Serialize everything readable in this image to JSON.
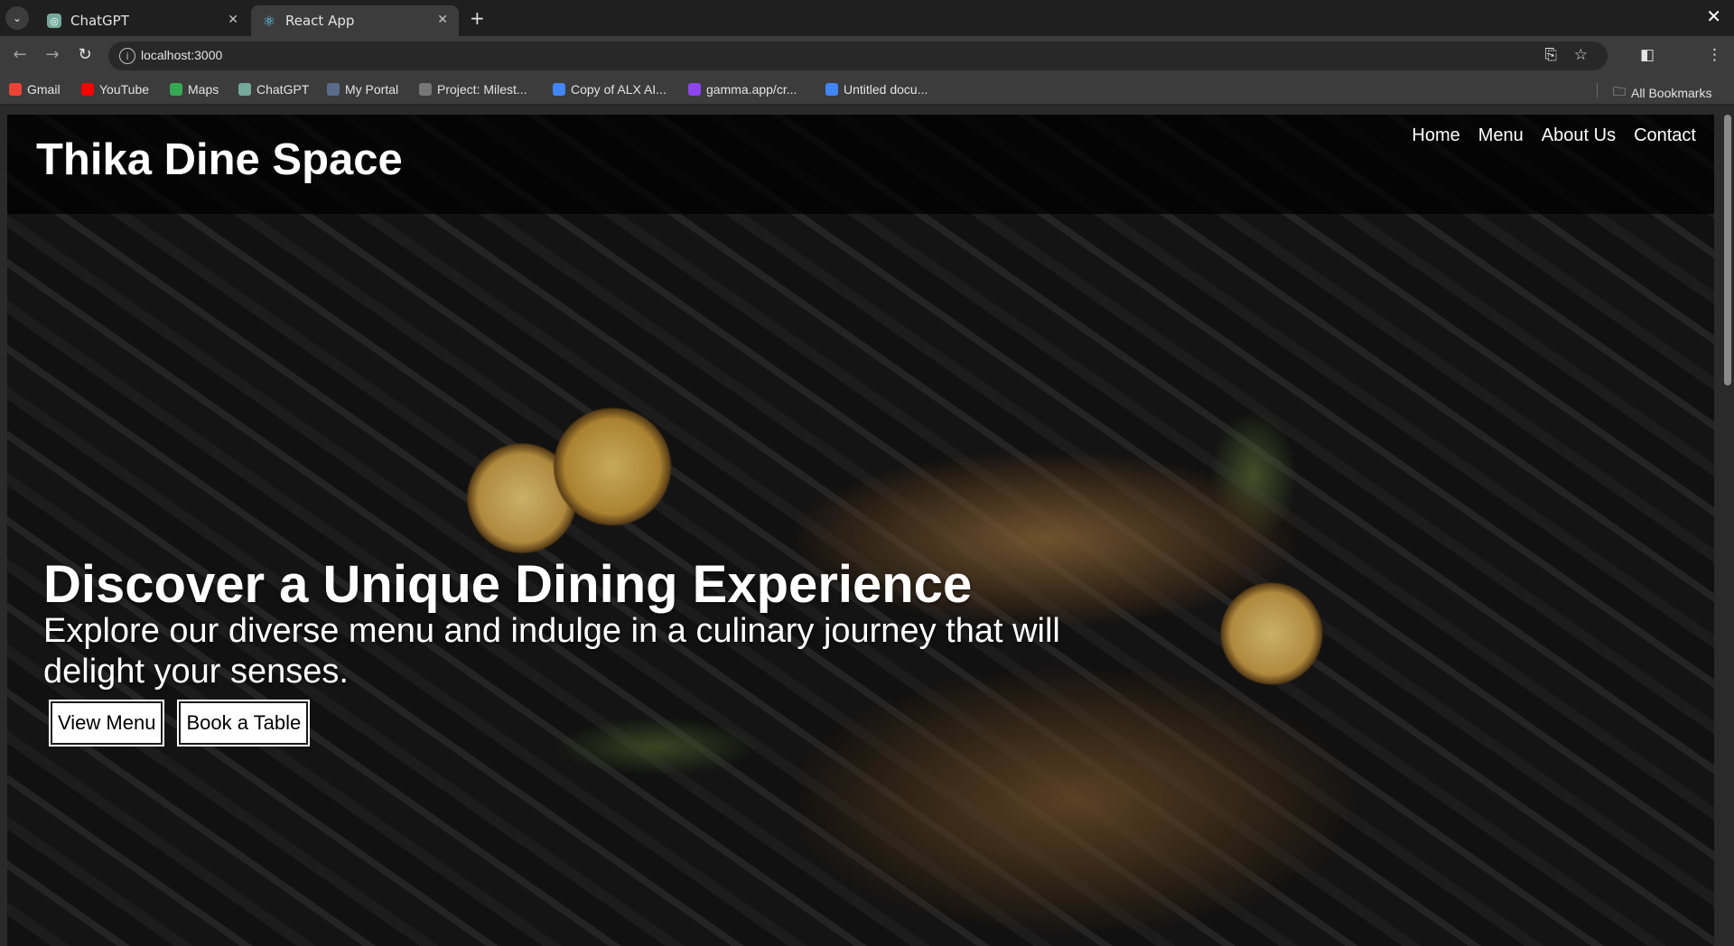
{
  "browser": {
    "tabs": [
      {
        "title": "ChatGPT",
        "active": false
      },
      {
        "title": "React App",
        "active": true
      }
    ],
    "url": "localhost:3000",
    "bookmarks": [
      {
        "label": "Gmail",
        "icon": "gmail-icon",
        "color": "#ea4335"
      },
      {
        "label": "YouTube",
        "icon": "youtube-icon",
        "color": "#ff0000"
      },
      {
        "label": "Maps",
        "icon": "maps-icon",
        "color": "#34a853"
      },
      {
        "label": "ChatGPT",
        "icon": "chatgpt-icon",
        "color": "#74aa9c"
      },
      {
        "label": "My Portal",
        "icon": "portal-icon",
        "color": "#5a6b8c"
      },
      {
        "label": "Project: Milest...",
        "icon": "project-icon",
        "color": "#777777"
      },
      {
        "label": "Copy of ALX AI...",
        "icon": "docs-icon",
        "color": "#4285f4"
      },
      {
        "label": "gamma.app/cr...",
        "icon": "gamma-icon",
        "color": "#8e44ef"
      },
      {
        "label": "Untitled docu...",
        "icon": "docs-icon",
        "color": "#4285f4"
      }
    ],
    "all_bookmarks_label": "All Bookmarks"
  },
  "site": {
    "title": "Thika Dine Space",
    "nav": [
      "Home",
      "Menu",
      "About Us",
      "Contact"
    ],
    "hero": {
      "heading": "Discover a Unique Dining Experience",
      "subheading": "Explore our diverse menu and indulge in a culinary journey that will delight your senses.",
      "buttons": [
        "View Menu",
        "Book a Table"
      ]
    }
  }
}
